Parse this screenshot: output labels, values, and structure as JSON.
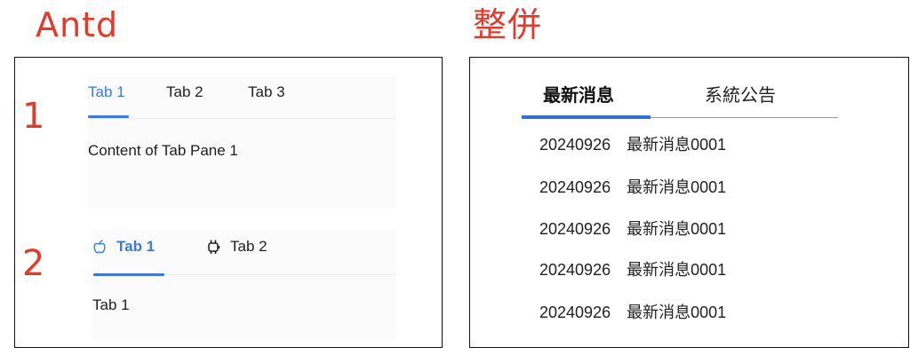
{
  "headings": {
    "left": "Antd",
    "right": "整併"
  },
  "left_panel": {
    "example1": {
      "number": "1",
      "tabs": [
        {
          "label": "Tab 1",
          "active": true
        },
        {
          "label": "Tab 2",
          "active": false
        },
        {
          "label": "Tab 3",
          "active": false
        }
      ],
      "content": "Content of Tab Pane 1"
    },
    "example2": {
      "number": "2",
      "tabs": [
        {
          "label": "Tab 1",
          "icon": "apple-icon",
          "active": true
        },
        {
          "label": "Tab 2",
          "icon": "android-icon",
          "active": false
        }
      ],
      "content": "Tab 1"
    }
  },
  "right_panel": {
    "tabs": [
      {
        "label": "最新消息",
        "active": true
      },
      {
        "label": "系統公告",
        "active": false
      }
    ],
    "items": [
      {
        "date": "20240926",
        "title": "最新消息0001"
      },
      {
        "date": "20240926",
        "title": "最新消息0001"
      },
      {
        "date": "20240926",
        "title": "最新消息0001"
      },
      {
        "date": "20240926",
        "title": "最新消息0001"
      },
      {
        "date": "20240926",
        "title": "最新消息0001"
      }
    ]
  },
  "colors": {
    "heading": "#e33a2c",
    "accent_antd": "#3b78e7",
    "accent_right": "#2f6fe0"
  }
}
